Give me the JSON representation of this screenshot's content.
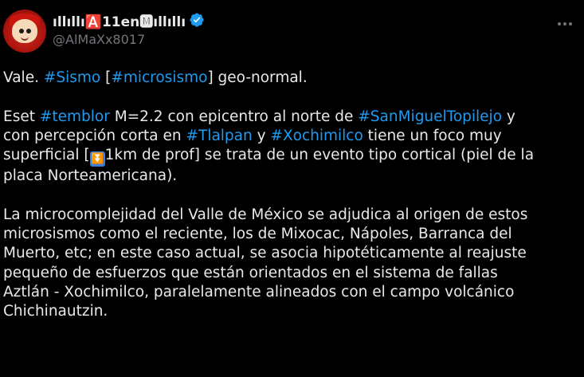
{
  "author": {
    "display_name": "ıllıllı🅰️11en🅼ıllıllı",
    "handle": "@AlMaXx8017",
    "verified": true,
    "avatar_icon": "south-park-character-avatar"
  },
  "more_icon": "more-options-icon",
  "tweet": {
    "para1": {
      "t1": "Vale. ",
      "h1": "#Sismo",
      "t2": " [",
      "h2": "#microsismo",
      "t3": "] geo-normal."
    },
    "para2": {
      "l1_t1": "Eset ",
      "l1_h1": "#temblor",
      "l1_t2": " M=2.2 con epicentro al norte de ",
      "l1_h2": "#SanMiguelTopilejo",
      "l1_t3": " y",
      "l2_t1": "con percepción corta en ",
      "l2_h1": "#Tlalpan",
      "l2_t2": " y ",
      "l2_h2": "#Xochimilco",
      "l2_t3": " tiene un foco muy",
      "l3_t1": "superficial [",
      "l3_emoji": "⏬",
      "l3_t2": "1km de prof] se trata de un evento tipo cortical (piel de la",
      "l4_t1": "placa Norteamericana)."
    },
    "para3": {
      "l1": "La microcomplejidad del Valle de México se adjudica al origen de estos",
      "l2": "microsismos como el reciente, los de Mixocac, Nápoles, Barranca del",
      "l3": "Muerto, etc; en este caso actual, se asocia hipotéticamente al reajuste",
      "l4": "pequeño de esfuerzos que están orientados en el sistema de fallas",
      "l5": "Aztlán - Xochimilco, paralelamente alineados con el campo volcánico",
      "l6": "Chichinautzin."
    }
  },
  "colors": {
    "background": "#000000",
    "text": "#e7e9ea",
    "muted": "#71767b",
    "link": "#1d9bf0"
  }
}
